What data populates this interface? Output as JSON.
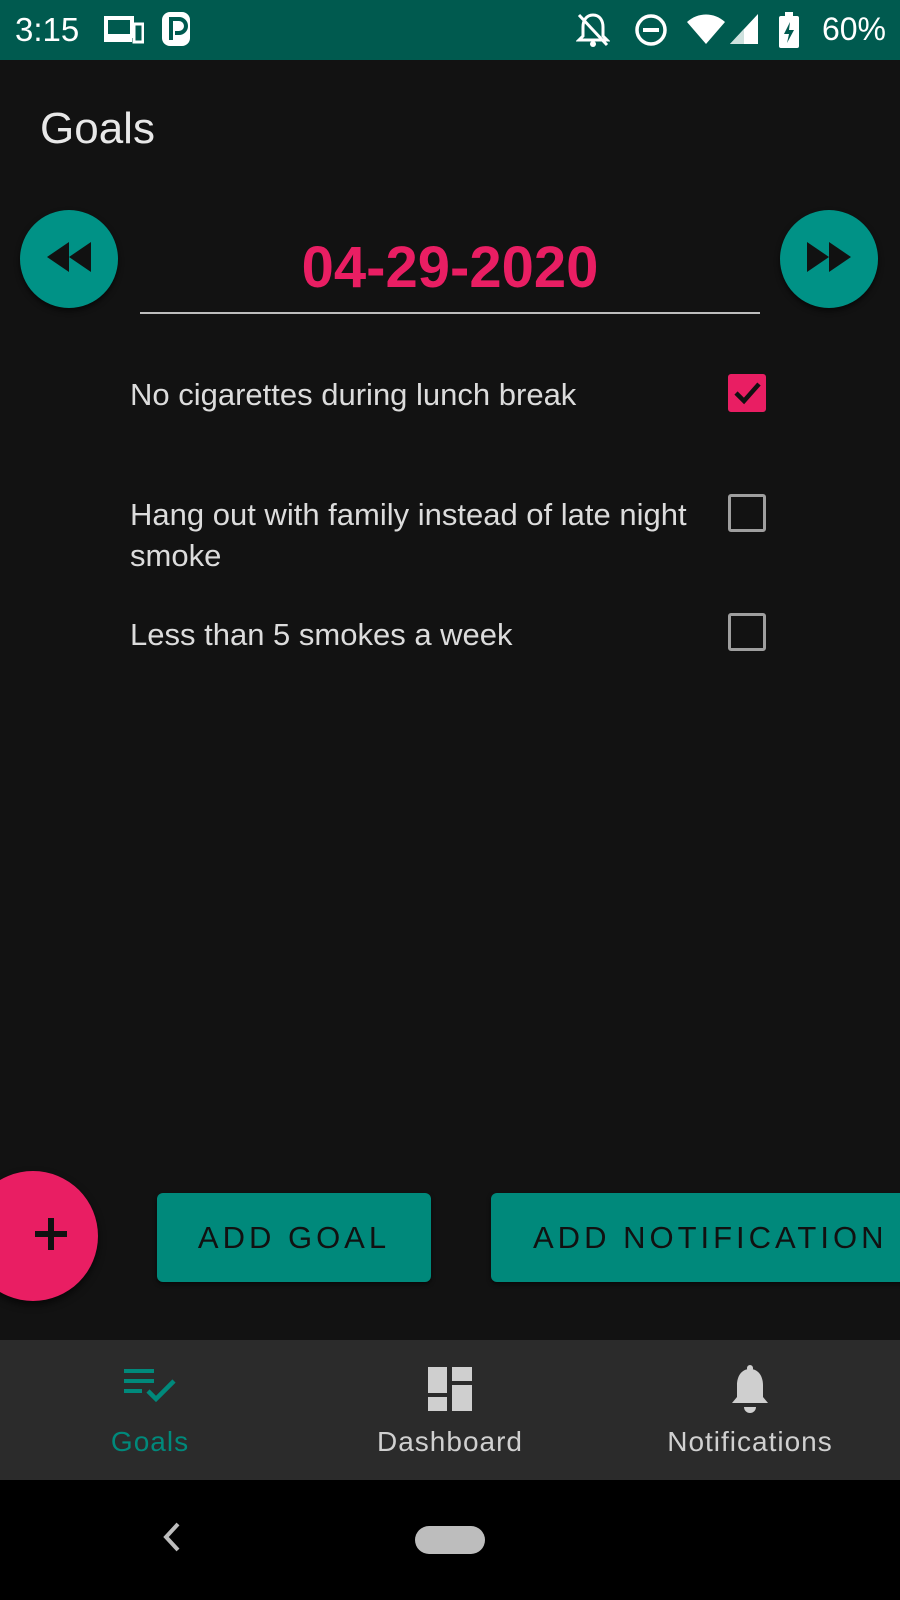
{
  "status_bar": {
    "time": "3:15",
    "battery": "60%",
    "icons": [
      "devices-icon",
      "parking-icon",
      "notifications-off-icon",
      "do-not-disturb-icon",
      "wifi-icon",
      "signal-icon",
      "battery-charging-icon"
    ]
  },
  "page": {
    "title": "Goals"
  },
  "date_nav": {
    "date": "04-29-2020",
    "prev_icon": "rewind-icon",
    "next_icon": "fast-forward-icon"
  },
  "goals": [
    {
      "text": "No cigarettes during lunch break",
      "checked": true
    },
    {
      "text": "Hang out with family instead of late night smoke",
      "checked": false
    },
    {
      "text": "Less than 5 smokes a week",
      "checked": false
    }
  ],
  "actions": {
    "fab_icon": "plus-icon",
    "add_goal_label": "ADD GOAL",
    "add_notification_label": "ADD NOTIFICATION"
  },
  "bottom_nav": {
    "items": [
      {
        "label": "Goals",
        "icon": "playlist-check-icon",
        "active": true
      },
      {
        "label": "Dashboard",
        "icon": "dashboard-icon",
        "active": false
      },
      {
        "label": "Notifications",
        "icon": "bell-icon",
        "active": false
      }
    ]
  },
  "colors": {
    "accent": "#e91e63",
    "primary": "#00897b",
    "status_bar": "#005a4f",
    "background": "#121212"
  }
}
